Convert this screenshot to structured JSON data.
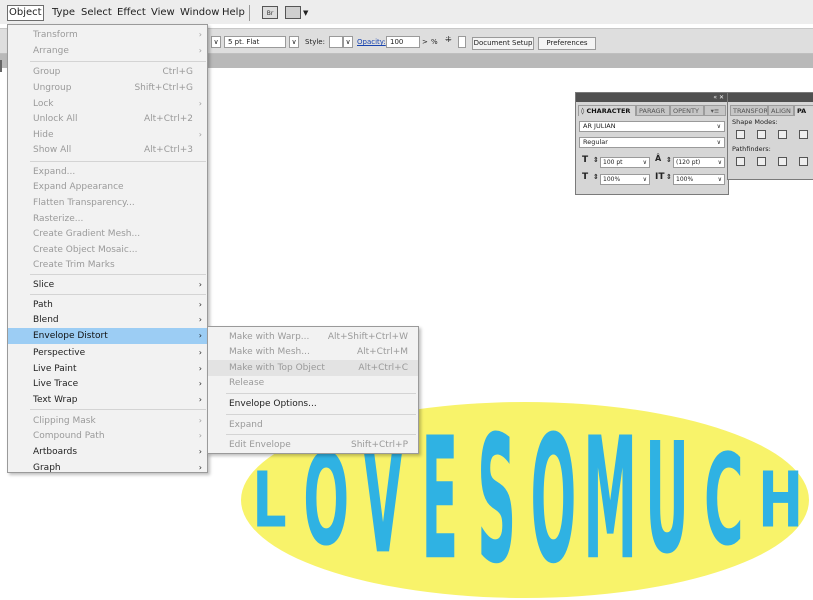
{
  "menubar": {
    "items": [
      "Object",
      "Type",
      "Select",
      "Effect",
      "View",
      "Window",
      "Help"
    ],
    "br_icon": "Br",
    "arrange_icon": "arrange-documents-icon"
  },
  "controlbar": {
    "stroke_label": "5 pt. Flat",
    "style_label": "Style:",
    "opacity_label": "Opacity:",
    "opacity_value": "100",
    "percent": "%",
    "document_setup": "Document Setup",
    "preferences": "Preferences"
  },
  "object_menu": {
    "items": [
      {
        "label": "Transform",
        "shortcut": "",
        "submenu": true,
        "disabled": true
      },
      {
        "label": "Arrange",
        "shortcut": "",
        "submenu": true,
        "disabled": true
      },
      {
        "label": "Group",
        "shortcut": "Ctrl+G",
        "submenu": false,
        "disabled": true
      },
      {
        "label": "Ungroup",
        "shortcut": "Shift+Ctrl+G",
        "submenu": false,
        "disabled": true
      },
      {
        "label": "Lock",
        "shortcut": "",
        "submenu": true,
        "disabled": true
      },
      {
        "label": "Unlock All",
        "shortcut": "Alt+Ctrl+2",
        "submenu": false,
        "disabled": true
      },
      {
        "label": "Hide",
        "shortcut": "",
        "submenu": true,
        "disabled": true
      },
      {
        "label": "Show All",
        "shortcut": "Alt+Ctrl+3",
        "submenu": false,
        "disabled": true
      },
      {
        "label": "Expand...",
        "shortcut": "",
        "submenu": false,
        "disabled": true
      },
      {
        "label": "Expand Appearance",
        "shortcut": "",
        "submenu": false,
        "disabled": true
      },
      {
        "label": "Flatten Transparency...",
        "shortcut": "",
        "submenu": false,
        "disabled": true
      },
      {
        "label": "Rasterize...",
        "shortcut": "",
        "submenu": false,
        "disabled": true
      },
      {
        "label": "Create Gradient Mesh...",
        "shortcut": "",
        "submenu": false,
        "disabled": true
      },
      {
        "label": "Create Object Mosaic...",
        "shortcut": "",
        "submenu": false,
        "disabled": true
      },
      {
        "label": "Create Trim Marks",
        "shortcut": "",
        "submenu": false,
        "disabled": true
      },
      {
        "label": "Slice",
        "shortcut": "",
        "submenu": true,
        "disabled": false
      },
      {
        "label": "Path",
        "shortcut": "",
        "submenu": true,
        "disabled": false
      },
      {
        "label": "Blend",
        "shortcut": "",
        "submenu": true,
        "disabled": false
      },
      {
        "label": "Envelope Distort",
        "shortcut": "",
        "submenu": true,
        "disabled": false
      },
      {
        "label": "Perspective",
        "shortcut": "",
        "submenu": true,
        "disabled": false
      },
      {
        "label": "Live Paint",
        "shortcut": "",
        "submenu": true,
        "disabled": false
      },
      {
        "label": "Live Trace",
        "shortcut": "",
        "submenu": true,
        "disabled": false
      },
      {
        "label": "Text Wrap",
        "shortcut": "",
        "submenu": true,
        "disabled": false
      },
      {
        "label": "Clipping Mask",
        "shortcut": "",
        "submenu": true,
        "disabled": true
      },
      {
        "label": "Compound Path",
        "shortcut": "",
        "submenu": true,
        "disabled": true
      },
      {
        "label": "Artboards",
        "shortcut": "",
        "submenu": true,
        "disabled": false
      },
      {
        "label": "Graph",
        "shortcut": "",
        "submenu": true,
        "disabled": false
      }
    ]
  },
  "envelope_submenu": {
    "items": [
      {
        "label": "Make with Warp...",
        "shortcut": "Alt+Shift+Ctrl+W",
        "disabled": true
      },
      {
        "label": "Make with Mesh...",
        "shortcut": "Alt+Ctrl+M",
        "disabled": true
      },
      {
        "label": "Make with Top Object",
        "shortcut": "Alt+Ctrl+C",
        "disabled": true
      },
      {
        "label": "Release",
        "shortcut": "",
        "disabled": true
      },
      {
        "label": "Envelope Options...",
        "shortcut": "",
        "disabled": false
      },
      {
        "label": "Expand",
        "shortcut": "",
        "disabled": true
      },
      {
        "label": "Edit Envelope",
        "shortcut": "Shift+Ctrl+P",
        "disabled": true
      }
    ]
  },
  "character_panel": {
    "tabs": [
      "◊ CHARACTER",
      "PARAGR",
      "OPENTY"
    ],
    "font_family": "AR JULIAN",
    "font_style": "Regular",
    "font_size": "100 pt",
    "leading": "(120 pt)",
    "horiz_scale": "100%",
    "vert_scale": "100%",
    "collapse": "«",
    "close": "✕"
  },
  "pathfinder_panel": {
    "tabs": [
      "TRANSFORM",
      "ALIGN",
      "PA"
    ],
    "shape_modes_label": "Shape Modes:",
    "pathfinders_label": "Pathfinders:"
  },
  "artwork": {
    "text": "LOVESOMUCH",
    "ellipse_color": "#f8f36a",
    "text_color": "#2fb2e3"
  },
  "colors": {
    "menu_highlight": "#9ccdf4",
    "menu_bg": "#f2f2f2",
    "disabled_text": "#9a9a9a"
  }
}
